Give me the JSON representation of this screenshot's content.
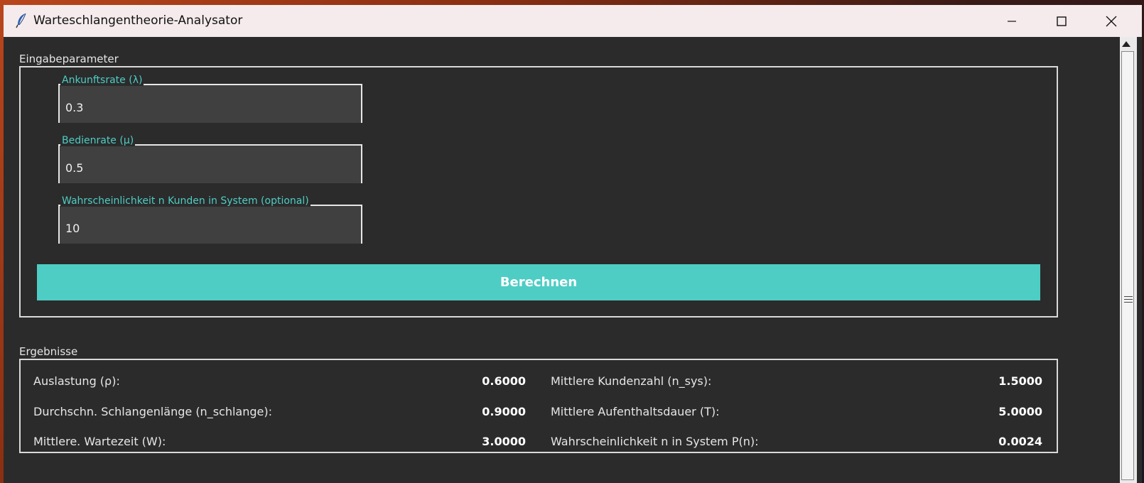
{
  "window": {
    "title": "Warteschlangentheorie-Analysator"
  },
  "input_section": {
    "label": "Eingabeparameter",
    "fields": [
      {
        "label": "Ankunftsrate (λ)",
        "value": "0.3"
      },
      {
        "label": "Bedienrate (μ)",
        "value": "0.5"
      },
      {
        "label": "Wahrscheinlichkeit n Kunden in System (optional)",
        "value": "10"
      }
    ],
    "calculate_label": "Berechnen"
  },
  "results_section": {
    "label": "Ergebnisse",
    "left": [
      {
        "label": "Auslastung (ρ):",
        "value": "0.6000"
      },
      {
        "label": "Durchschn. Schlangenlänge (n_schlange):",
        "value": "0.9000"
      },
      {
        "label": "Mittlere. Wartezeit (W):",
        "value": "3.0000"
      }
    ],
    "right": [
      {
        "label": "Mittlere Kundenzahl (n_sys):",
        "value": "1.5000"
      },
      {
        "label": "Mittlere Aufenthaltsdauer (T):",
        "value": "5.0000"
      },
      {
        "label": "Wahrscheinlichkeit n in System P(n):",
        "value": "0.0024"
      }
    ]
  },
  "colors": {
    "accent": "#4ecdc4",
    "background": "#2b2b2b",
    "field_bg": "#404040"
  },
  "icons": [
    "feather-icon",
    "minimize-icon",
    "maximize-icon",
    "close-icon",
    "scroll-up-arrow-icon"
  ]
}
